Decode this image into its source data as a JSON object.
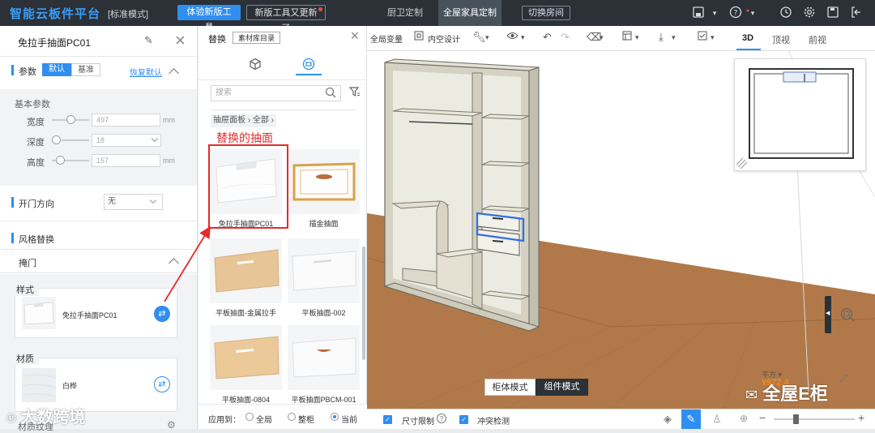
{
  "topbar": {
    "logo": "智能云板件平台",
    "mode_label": "[标准模式]",
    "new_tool_btn": "体验新版工具",
    "new_tool_updated_btn": "新版工具又更新了",
    "tabs": [
      {
        "label": "厨卫定制",
        "active": false
      },
      {
        "label": "全屋家具定制",
        "active": true
      }
    ],
    "switch_room_btn": "切换房间"
  },
  "left_panel": {
    "title": "免拉手抽面PC01",
    "params": {
      "label": "参数",
      "tab_default": "默认",
      "tab_base": "基准",
      "restore_link": "恢复默认",
      "basic_label": "基本参数",
      "width": {
        "label": "宽度",
        "value": "497",
        "unit": "mm"
      },
      "depth": {
        "label": "深度",
        "value": "18",
        "unit": "mm"
      },
      "height": {
        "label": "高度",
        "value": "157",
        "unit": "mm"
      }
    },
    "door_direction": {
      "label": "开门方向",
      "value": "无"
    },
    "style_replace": {
      "label": "风格替换",
      "sub_label": "掩门",
      "style_card": {
        "tag": "样式",
        "name": "免拉手抽面PC01"
      },
      "material_card": {
        "tag": "材质",
        "name": "白桦"
      }
    },
    "texture_label": "材质纹理"
  },
  "replace_panel": {
    "title": "替换",
    "library_btn": "素材库目录",
    "search_placeholder": "搜索",
    "breadcrumb": "抽屉面板 › 全部 ›",
    "annotation": "替换的抽面",
    "items": [
      {
        "name": "免拉手抽面PC01"
      },
      {
        "name": "描金抽面"
      },
      {
        "name": "平板抽面-金属拉手"
      },
      {
        "name": "平板抽面-002"
      },
      {
        "name": "平板抽面-0804"
      },
      {
        "name": "平板抽面PBCM-001"
      }
    ],
    "apply_label": "应用到：",
    "apply_options": [
      {
        "label": "全局",
        "selected": false
      },
      {
        "label": "整柜",
        "selected": false
      },
      {
        "label": "当前",
        "selected": true
      }
    ]
  },
  "toolbar": {
    "items": [
      "全局变量",
      "内空设计"
    ]
  },
  "view_tabs": [
    {
      "label": "3D",
      "active": true
    },
    {
      "label": "顶视",
      "active": false
    },
    {
      "label": "前视",
      "active": false
    }
  ],
  "viewport": {
    "mode_cabinet": "柜体模式",
    "mode_component": "组件模式",
    "price_label": "平方",
    "price_value": "¥972.4"
  },
  "statusbar": {
    "size_limit": "尺寸限制",
    "conflict_check": "冲突检测"
  },
  "watermarks": {
    "left": "大数跨境",
    "right": "全屋E柜"
  },
  "colors": {
    "accent": "#2f8ef0",
    "topbar_bg": "#2b3137",
    "annotation_red": "#e52b2b",
    "wood_floor": "#b17949"
  }
}
